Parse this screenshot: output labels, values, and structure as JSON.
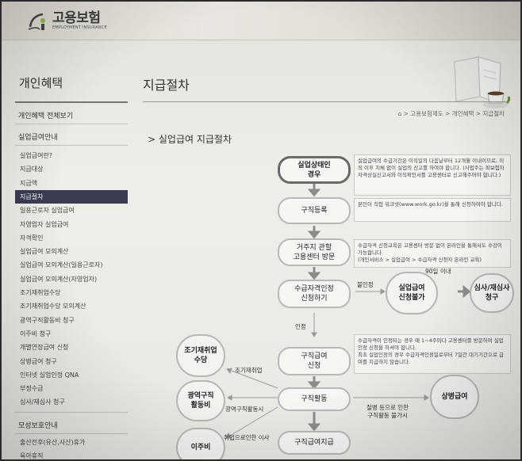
{
  "brand": {
    "title": "고용보험",
    "subtitle": "EMPLOYMENT INSURANCE"
  },
  "sidebar": {
    "title": "개인혜택",
    "overview": "개인혜택 전체보기",
    "group1": "실업급여안내",
    "items": [
      "실업급여란?",
      "지급대상",
      "지급액",
      "지급절차",
      "일용근로자 실업급여",
      "자영업자 실업급여",
      "자격확인",
      "실업급여 모의계산",
      "실업급여 모의계산(일용근로자)",
      "실업급여 모의계산(자영업자)",
      "조기재취업수당",
      "조기재취업수당 모의계산",
      "광역구직활동비 청구",
      "이주비 청구",
      "개별연장급여 신청",
      "상병급여 청구",
      "인터넷 실업인정 QNA",
      "부정수급",
      "심사/재심사 청구"
    ],
    "active_index": 3,
    "group2": "모성보호안내",
    "group2_items": [
      "출산전후(유산,사산)휴가",
      "육아휴직"
    ]
  },
  "main": {
    "page_title": "지급절차",
    "breadcrumb": "> 고용보험제도 > 개인혜택 > 지급절차",
    "section_title": "실업급여 지급절차"
  },
  "flow": {
    "n1": "실업상태인\n경우",
    "n2": "구직등록",
    "n3": "거주지 관할\n고용센터 방문",
    "n4": "수급자격인정\n신청하기",
    "n5": "구직급여\n신청",
    "n6": "구직활동",
    "n7": "구직급여지급",
    "c_unpaid": "실업급여\n신청불가",
    "c_review": "심사/재심사\n청구",
    "c_early": "조기재취업\n수당",
    "c_area": "광역구직\n활동비",
    "c_move": "이주비",
    "c_sick": "상병급여",
    "label_reject": "불인정",
    "label_90": "90일 이내",
    "label_approved": "인정",
    "label_early": "조기재취업",
    "label_area": "광역구직활동시",
    "label_move": "취업으로인한 이사",
    "label_sick": "질병 등으로 인한\n구직활동 불가시",
    "note1": "실업급여의 수급기간은 이직일의 다음날부터 12개월 이내이므로, 이직 이후 지체 없이 실업의 신고를 하여야 합니다. (사업주는 피보험자 자격상실신고서와 이직확인서를 고용센터로 신고해주어야 합니다.)",
    "note2": "본인이 직접 워크넷(www.work.go.kr)을 통해 신청하여야 합니다.",
    "note3": "수급자격 신청교육은 고용센터 방문 없이 온라인을 통해서도 수강이 가능합니다.\n(개인서비스 > 실업급여 > 수급자격 신청자 온라인 교육)",
    "note4": "수급자격이 인정되는 경우 매 1~4주마다 고용센터를 방문하여 실업인정 신청을 하셔야 합니다.\n최초 실업인정의 경우 수급자격인정일로부터 7일간 대기기간으로 급여를 지급하지 않습니다."
  }
}
